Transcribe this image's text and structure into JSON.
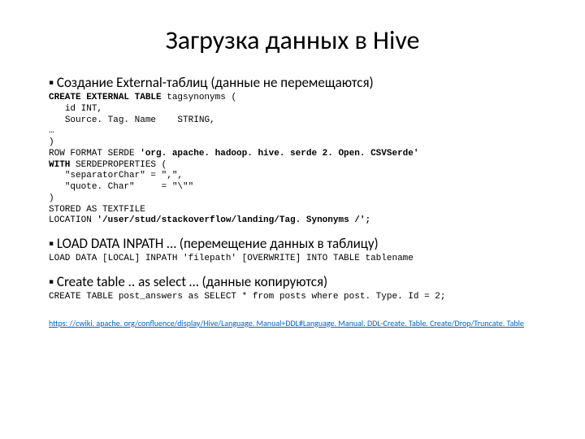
{
  "title": "Загрузка данных в Hive",
  "sec1": {
    "bullet": "Создание External-таблиц (данные не перемещаются)",
    "kw1": "CREATE EXTERNAL TABLE",
    "l1b": " tagsynonyms (",
    "l2": "   id INT,",
    "l3": "   Source. Tag. Name    STRING,",
    "l4": "…",
    "l5": ")",
    "l6a": "ROW FORMAT SERDE ",
    "l6b": "'org. apache. hadoop. hive. serde 2. Open. CSVSerde'",
    "l7a": "WITH",
    "l7b": " SERDEPROPERTIES (",
    "l8": "   \"separatorChar\" = \",\",",
    "l9": "   \"quote. Char\"     = \"\\\"\"",
    "l10": ")",
    "l11": "STORED AS TEXTFILE",
    "l12a": "LOCATION ",
    "l12b": "'/user/stud/stackoverflow/landing/Tag. Synonyms /';"
  },
  "sec2": {
    "bullet": "LOAD DATA INPATH … (перемещение данных в таблицу)",
    "code": "LOAD DATA [LOCAL] INPATH 'filepath' [OVERWRITE] INTO TABLE tablename"
  },
  "sec3": {
    "bullet": "Create table .. as select … (данные копируются)",
    "code": "CREATE TABLE post_answers as SELECT * from posts where post. Type. Id = 2;"
  },
  "link": "https: //cwiki. apache. org/confluence/display/Hive/Language. Manual+DDL#Language. Manual. DDL-Create. Table. Create/Drop/Truncate. Table"
}
